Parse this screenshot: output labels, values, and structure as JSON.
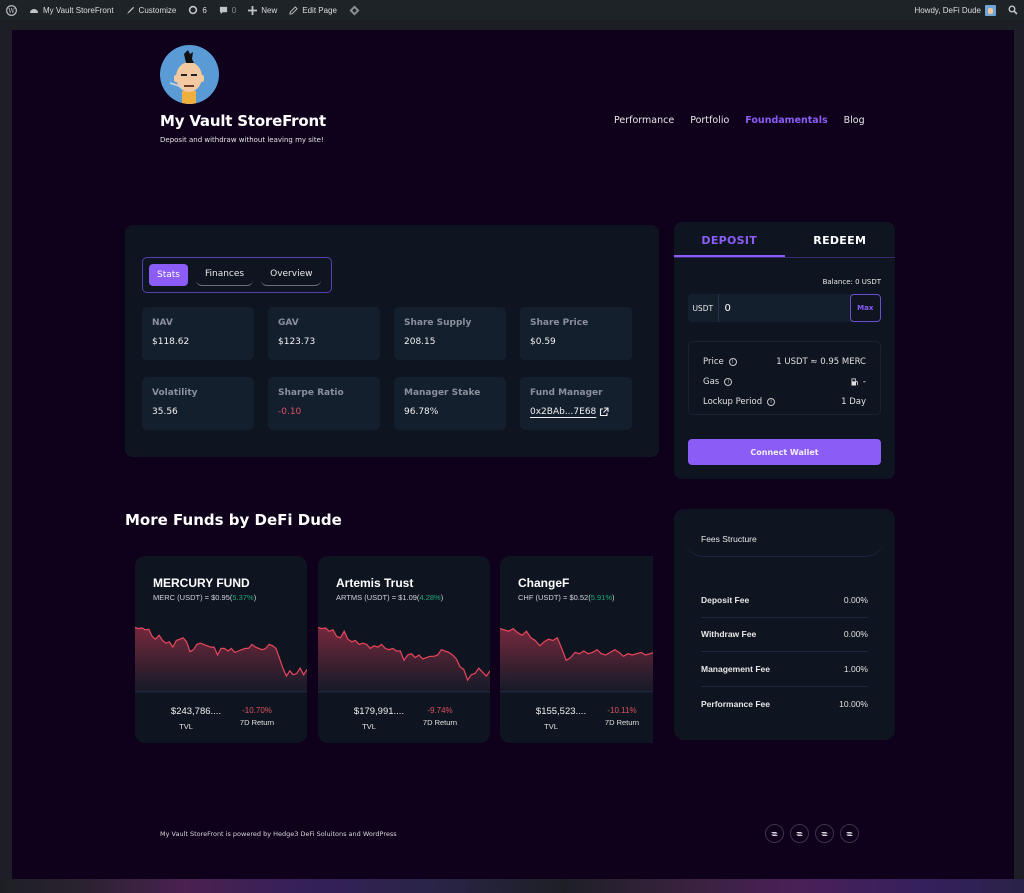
{
  "admin_bar": {
    "site_name": "My Vault StoreFront",
    "customize": "Customize",
    "updates_count": "6",
    "comments_count": "0",
    "new_label": "New",
    "edit_page": "Edit Page",
    "greeting": "Howdy, DeFi Dude"
  },
  "header": {
    "site_title": "My Vault StoreFront",
    "tagline": "Deposit and withdraw without leaving my site!",
    "nav": [
      {
        "label": "Performance",
        "active": false
      },
      {
        "label": "Portfolio",
        "active": false
      },
      {
        "label": "Foundamentals",
        "active": true
      },
      {
        "label": "Blog",
        "active": false
      }
    ]
  },
  "stats_panel": {
    "tabs": [
      {
        "label": "Stats",
        "active": true
      },
      {
        "label": "Finances",
        "active": false
      },
      {
        "label": "Overview",
        "active": false
      }
    ],
    "stats": [
      {
        "label": "NAV",
        "value": "$118.62"
      },
      {
        "label": "GAV",
        "value": "$123.73"
      },
      {
        "label": "Share Supply",
        "value": "208.15"
      },
      {
        "label": "Share Price",
        "value": "$0.59"
      },
      {
        "label": "Volatility",
        "value": "35.56"
      },
      {
        "label": "Sharpe Ratio",
        "value": "-0.10",
        "negative": true
      },
      {
        "label": "Manager Stake",
        "value": "96.78%"
      },
      {
        "label": "Fund Manager",
        "value": "0x2BAb...7E68",
        "link": true
      }
    ]
  },
  "deposit_panel": {
    "tabs": [
      {
        "label": "DEPOSIT",
        "active": true
      },
      {
        "label": "REDEEM",
        "active": false
      }
    ],
    "balance": "Balance: 0 USDT",
    "currency": "USDT",
    "amount_value": "0",
    "max_label": "Max",
    "info": [
      {
        "label": "Price",
        "value": "1 USDT ≈ 0.95 MERC"
      },
      {
        "label": "Gas",
        "value": "-"
      },
      {
        "label": "Lockup Period",
        "value": "1 Day"
      }
    ],
    "connect_label": "Connect Wallet"
  },
  "more_funds": {
    "title": "More Funds by DeFi Dude",
    "funds": [
      {
        "name": "MERCURY FUND",
        "pair": "MERC (USDT) = $0.95(",
        "change": "5.37%",
        "tvl": "$243,786....",
        "tvl_label": "TVL",
        "return": "-10.70%",
        "return_label": "7D Return",
        "spark": [
          0.92,
          0.9,
          0.91,
          0.88,
          0.89,
          0.78,
          0.74,
          0.8,
          0.72,
          0.68,
          0.7,
          0.62,
          0.72,
          0.74,
          0.76,
          0.7,
          0.55,
          0.58,
          0.66,
          0.68,
          0.66,
          0.64,
          0.62,
          0.62,
          0.5,
          0.6,
          0.6,
          0.56,
          0.6,
          0.54,
          0.56,
          0.58,
          0.6,
          0.6,
          0.66,
          0.62,
          0.6,
          0.58,
          0.6,
          0.66,
          0.64,
          0.6,
          0.45,
          0.3,
          0.18,
          0.26,
          0.2,
          0.22,
          0.3,
          0.2,
          0.28
        ]
      },
      {
        "name": "Artemis Trust",
        "pair": "ARTMS (USDT) = $1.09(",
        "change": "4.28%",
        "tvl": "$179,991....",
        "tvl_label": "TVL",
        "return": "-9.74%",
        "return_label": "7D Return",
        "spark": [
          0.92,
          0.9,
          0.91,
          0.86,
          0.88,
          0.78,
          0.76,
          0.86,
          0.74,
          0.7,
          0.72,
          0.66,
          0.68,
          0.66,
          0.6,
          0.64,
          0.62,
          0.66,
          0.6,
          0.58,
          0.6,
          0.56,
          0.56,
          0.42,
          0.5,
          0.52,
          0.46,
          0.5,
          0.44,
          0.46,
          0.48,
          0.48,
          0.5,
          0.58,
          0.56,
          0.54,
          0.5,
          0.44,
          0.32,
          0.28,
          0.12,
          0.2,
          0.22,
          0.3,
          0.24,
          0.18,
          0.26
        ]
      },
      {
        "name": "ChangeF",
        "pair": "CHF (USDT) = $0.52(",
        "change": "5.91%",
        "tvl": "$155,523....",
        "tvl_label": "TVL",
        "return": "-10.11%",
        "return_label": "7D Return",
        "spark": [
          0.9,
          0.88,
          0.86,
          0.9,
          0.84,
          0.8,
          0.86,
          0.76,
          0.72,
          0.64,
          0.7,
          0.74,
          0.72,
          0.76,
          0.6,
          0.42,
          0.46,
          0.54,
          0.52,
          0.56,
          0.52,
          0.54,
          0.58,
          0.52,
          0.5,
          0.54,
          0.58,
          0.54,
          0.48,
          0.52,
          0.5,
          0.52,
          0.54,
          0.5,
          0.52,
          0.54,
          0.5,
          0.4,
          0.34,
          0.28
        ]
      }
    ]
  },
  "fees": {
    "title": "Fees Structure",
    "rows": [
      {
        "label": "Deposit Fee",
        "value": "0.00%"
      },
      {
        "label": "Withdraw Fee",
        "value": "0.00%"
      },
      {
        "label": "Management Fee",
        "value": "1.00%"
      },
      {
        "label": "Performance Fee",
        "value": "10.00%"
      }
    ]
  },
  "footer": {
    "text": "My Vault StoreFront is powered by Hedge3 DeFi Soluitons and WordPress",
    "social_count": 4
  },
  "colors": {
    "accent": "#8b5cf6",
    "negative": "#e05260",
    "positive": "#1fa77a",
    "page_bg": "#0f001b",
    "panel_bg": "#0f1520"
  }
}
